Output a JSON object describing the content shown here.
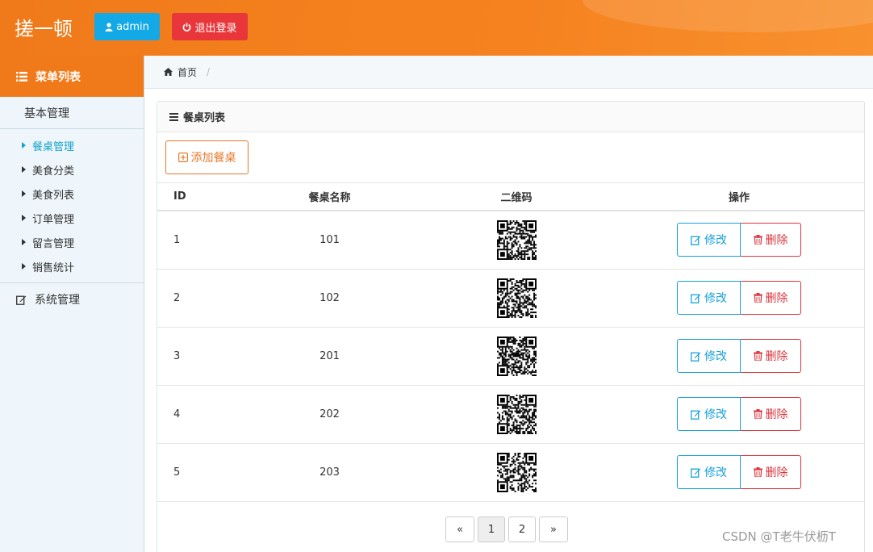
{
  "header": {
    "brand": "搓一顿",
    "user_button": "admin",
    "logout_button": "退出登录"
  },
  "sidebar": {
    "title": "菜单列表",
    "group1": "基本管理",
    "items": [
      {
        "label": "餐桌管理",
        "active": true
      },
      {
        "label": "美食分类"
      },
      {
        "label": "美食列表"
      },
      {
        "label": "订单管理"
      },
      {
        "label": "留言管理"
      },
      {
        "label": "销售统计"
      }
    ],
    "group2": "系统管理"
  },
  "breadcrumb": {
    "home": "首页",
    "separator": "/"
  },
  "panel": {
    "title": "餐桌列表",
    "add_button": "添加餐桌",
    "columns": [
      "ID",
      "餐桌名称",
      "二维码",
      "操作"
    ],
    "rows": [
      {
        "id": "1",
        "name": "101"
      },
      {
        "id": "2",
        "name": "102"
      },
      {
        "id": "3",
        "name": "201"
      },
      {
        "id": "4",
        "name": "202"
      },
      {
        "id": "5",
        "name": "203"
      }
    ],
    "edit_label": "修改",
    "delete_label": "删除"
  },
  "pagination": {
    "prev": "«",
    "pages": [
      "1",
      "2"
    ],
    "current": "1",
    "next": "»"
  },
  "watermark": "CSDN @T老牛伏枥T",
  "colors": {
    "header": "#f5821f",
    "admin_button": "#12a9e6",
    "logout_button": "#e8363a",
    "active_menu": "#17a2c9",
    "add_button": "#e8792c",
    "edit_button": "#17a2d8",
    "delete_button": "#d9363e"
  }
}
